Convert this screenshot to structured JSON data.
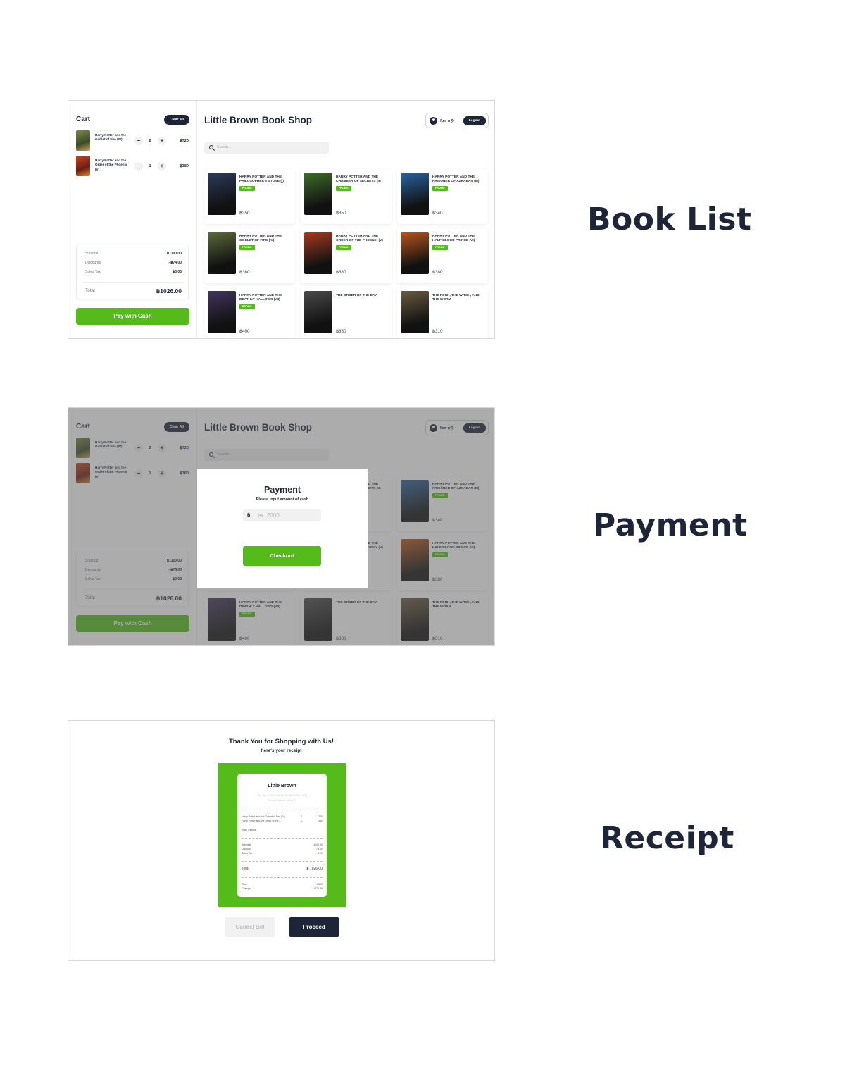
{
  "labels": {
    "book_list": "Book List",
    "payment": "Payment",
    "receipt": "Receipt"
  },
  "colors": {
    "brand_green": "#55bb1a",
    "navy": "#1e2538"
  },
  "cart": {
    "title": "Cart",
    "clear_label": "Clear All",
    "items": [
      {
        "name": "Harry Potter and the Goblet of Fire (IV)",
        "qty": "2",
        "price": "฿720"
      },
      {
        "name": "Harry Potter and the Order of the Phoenix (V)",
        "qty": "1",
        "price": "฿380"
      }
    ],
    "subtotal_label": "Subtotal",
    "subtotal": "฿1100.00",
    "discounts_label": "Discounts",
    "discounts": "- ฿74.00",
    "tax_label": "Sales Tax",
    "tax": "฿0.00",
    "total_label": "Total",
    "total": "฿1026.00",
    "pay_label": "Pay with Cash"
  },
  "header": {
    "title": "Little Brown Book Shop",
    "user": "fon ★彡",
    "logout_label": "Logout",
    "search_placeholder": "Search..."
  },
  "books": [
    {
      "title": "Harry Potter and the Philosopher's Stone (I)",
      "promo": "PROMO",
      "price": "฿350",
      "cover": "#2b3b5a"
    },
    {
      "title": "Harry Potter and the Chamber of Secrets (II)",
      "promo": "PROMO",
      "price": "฿350",
      "cover": "#3f6b2a"
    },
    {
      "title": "Harry Potter and the Prisoner of Azkaban (III)",
      "promo": "PROMO",
      "price": "฿340",
      "cover": "#2a62a0"
    },
    {
      "title": "Harry Potter and the Goblet of Fire (IV)",
      "promo": "PROMO",
      "price": "฿360",
      "cover": "#5b6a3a"
    },
    {
      "title": "Harry Potter and the Order of the Phoenix (V)",
      "promo": "PROMO",
      "price": "฿380",
      "cover": "#a63a1f"
    },
    {
      "title": "Harry Potter and the Half-Blood Prince (VI)",
      "promo": "PROMO",
      "price": "฿380",
      "cover": "#b9551a"
    },
    {
      "title": "Harry Potter and the Deathly Hallows (VII)",
      "promo": "PROMO",
      "price": "฿400",
      "cover": "#40355e"
    },
    {
      "title": "The Order of the Day",
      "promo": "",
      "price": "฿330",
      "cover": "#4a4a4a"
    },
    {
      "title": "The Fork, the Witch, and the Worm",
      "promo": "",
      "price": "฿310",
      "cover": "#6b5a40"
    }
  ],
  "payment_modal": {
    "title": "Payment",
    "subtitle": "Please input amount of cash",
    "currency": "฿",
    "placeholder": "ex. 2000",
    "checkout_label": "Checkout"
  },
  "receipt": {
    "thanks": "Thank You for Shopping with Us!",
    "subtitle": "here's your receipt",
    "shop": "Little Brown",
    "datetime": "Thu Jan 21 2021 05:34:07 GMT+0700 (+07)",
    "cashier": "Service Cashier: fon ★彡",
    "lines": [
      {
        "name": "Harry Potter and the Goblet of Fire (IV)",
        "qty": "2",
        "amount": "720"
      },
      {
        "name": "Harry Potter and the Order of the...",
        "qty": "1",
        "amount": "380"
      }
    ],
    "total_items": "Total 3 items",
    "subtotal_label": "Subtotal",
    "subtotal": "1100.00",
    "discount_label": "Discount",
    "discount": "- 74.00",
    "tax_label": "Sales Tax",
    "tax": "+ 0.00",
    "total_label": "Total",
    "total": "฿ 1026.00",
    "cash_label": "Cash",
    "cash": "2500",
    "change_label": "Change",
    "change": "1474.00",
    "cancel_label": "Cancel Bill",
    "proceed_label": "Proceed"
  }
}
